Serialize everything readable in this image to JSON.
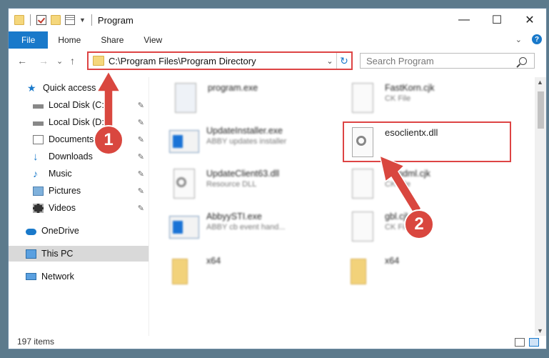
{
  "window": {
    "title": "Program"
  },
  "caption": {
    "minimize": "—",
    "maximize": "☐",
    "close": "✕"
  },
  "ribbon": {
    "tabs": [
      "File",
      "Home",
      "Share",
      "View"
    ],
    "expand": "⌄",
    "help": "?"
  },
  "nav": {
    "back": "←",
    "forward": "→",
    "recent": "⌄",
    "up": "↑"
  },
  "address": {
    "path": "C:\\Program Files\\Program Directory",
    "dropdown": "⌄",
    "refresh": "↻"
  },
  "search": {
    "placeholder": "Search Program"
  },
  "navpane": {
    "items": [
      {
        "label": "Quick access",
        "icon": "star-icon"
      },
      {
        "label": "Local Disk (C:)",
        "icon": "drive-icon",
        "pin": "📌"
      },
      {
        "label": "Local Disk (D:)",
        "icon": "drive-icon",
        "pin": "📌"
      },
      {
        "label": "Documents",
        "icon": "documents-icon",
        "pin": "📌"
      },
      {
        "label": "Downloads",
        "icon": "downloads-icon",
        "pin": "📌"
      },
      {
        "label": "Music",
        "icon": "music-icon",
        "pin": "📌"
      },
      {
        "label": "Pictures",
        "icon": "pictures-icon",
        "pin": "📌"
      },
      {
        "label": "Videos",
        "icon": "videos-icon",
        "pin": "📌"
      },
      {
        "label": "OneDrive",
        "icon": "cloud-icon"
      },
      {
        "label": "This PC",
        "icon": "computer-icon",
        "selected": true
      },
      {
        "label": "Network",
        "icon": "network-icon"
      }
    ]
  },
  "files": [
    {
      "name": "program.exe",
      "sub": "",
      "icon": "installer-icon"
    },
    {
      "name": "FastKorn.cjk",
      "sub": "CK File",
      "icon": "file-icon"
    },
    {
      "name": "UpdateInstaller.exe",
      "sub": "ABBY updates installer",
      "icon": "app-window-icon"
    },
    {
      "name": "esoclientx.dll",
      "sub": "",
      "icon": "dll-gear-icon"
    },
    {
      "name": "UpdateClient63.dll",
      "sub": "Resource DLL",
      "icon": "dll-gear-icon"
    },
    {
      "name": "Blandml.cjk",
      "sub": "CK File",
      "icon": "file-icon"
    },
    {
      "name": "AbbyySTI.exe",
      "sub": "ABBY cb event hand...",
      "icon": "app-window-icon"
    },
    {
      "name": "gbl.cjk",
      "sub": "CK File",
      "icon": "file-icon"
    },
    {
      "name": "x64",
      "sub": "",
      "icon": "folder-icon"
    },
    {
      "name": "x64",
      "sub": "",
      "icon": "folder-icon"
    }
  ],
  "callouts": [
    "1",
    "2"
  ],
  "status": {
    "items": "197 items"
  },
  "colors": {
    "accent": "#1979ca",
    "highlight": "#d44",
    "badge": "#d9473f"
  }
}
